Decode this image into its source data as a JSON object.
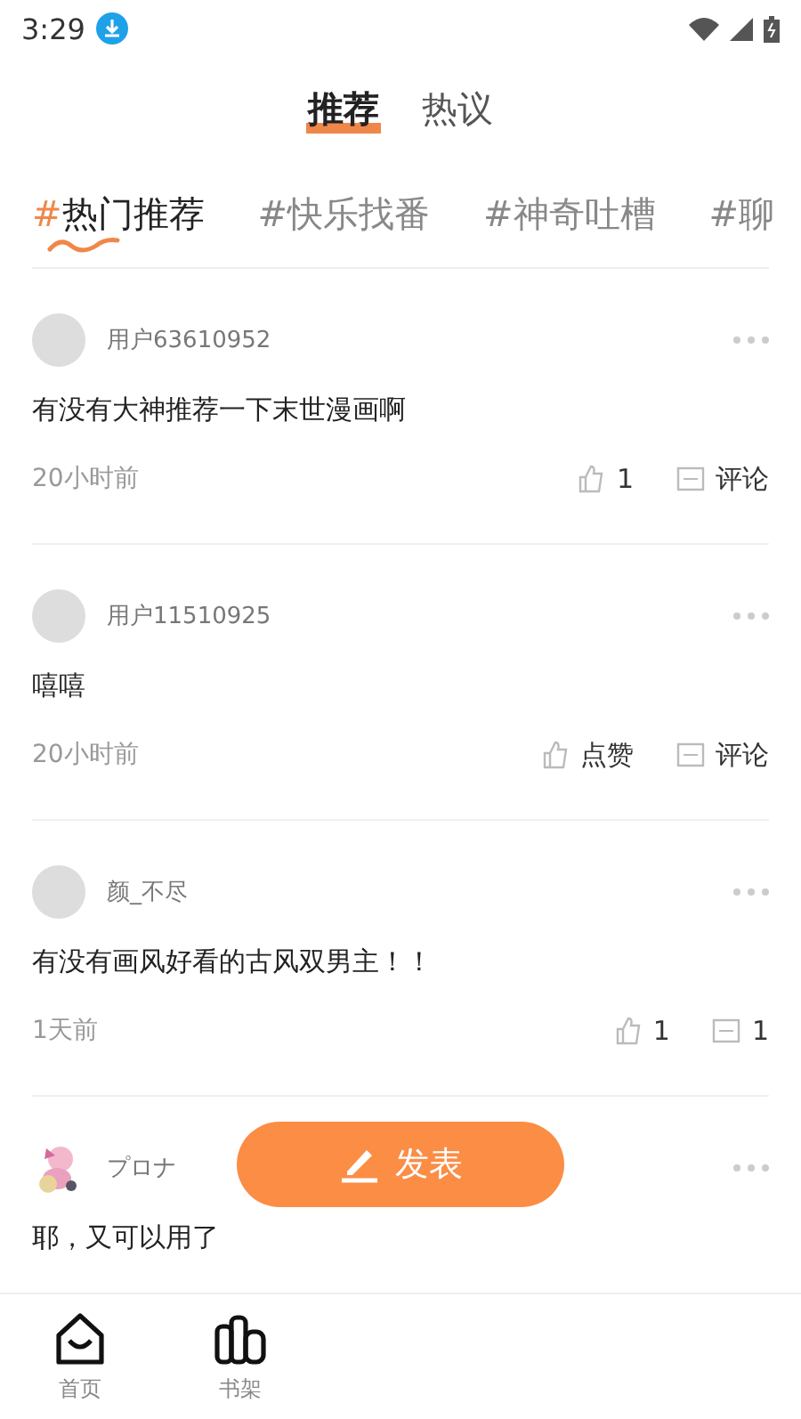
{
  "status_bar": {
    "time": "3:29"
  },
  "tabs": [
    {
      "label": "推荐",
      "selected": true
    },
    {
      "label": "热议",
      "selected": false
    }
  ],
  "topics": [
    {
      "hash": "#",
      "label": "热门推荐",
      "selected": true
    },
    {
      "hash": "#",
      "label": "快乐找番",
      "selected": false
    },
    {
      "hash": "#",
      "label": "神奇吐槽",
      "selected": false
    },
    {
      "hash": "#",
      "label": "聊",
      "selected": false
    }
  ],
  "posts": [
    {
      "user": "用户63610952",
      "kind": "plain",
      "content": "有没有大神推荐一下末世漫画啊",
      "time": "20小时前",
      "likes": "1",
      "comments": "评论"
    },
    {
      "user": "用户11510925",
      "kind": "plain",
      "content": "嘻嘻",
      "time": "20小时前",
      "likes": "点赞",
      "comments": "评论"
    },
    {
      "user": "颜_不尽",
      "kind": "plain",
      "content": "有没有画风好看的古风双男主！！",
      "time": "1天前",
      "likes": "1",
      "comments": "1"
    },
    {
      "user": "プロナ",
      "kind": "picture",
      "content": "耶，又可以用了"
    }
  ],
  "publish_button": {
    "label": "发表"
  },
  "bottom_nav": [
    {
      "label": "首页"
    },
    {
      "label": "书架"
    }
  ]
}
